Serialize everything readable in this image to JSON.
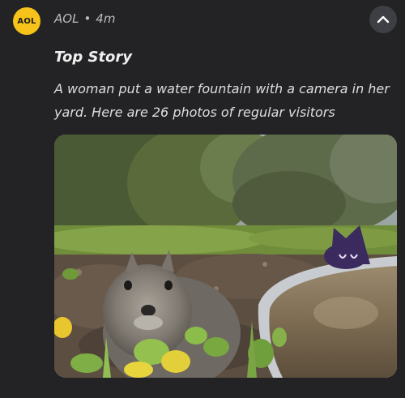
{
  "notification": {
    "app_icon_text": "AOL",
    "app_name": "AOL",
    "separator": "•",
    "time_ago": "4m",
    "title": "Top Story",
    "body": "A woman put a water fountain with a camera in her yard. Here are 26 photos of regular visitors",
    "collapse_icon": "chevron-up-icon"
  },
  "colors": {
    "background": "#232325",
    "aol_badge": "#f7c21a",
    "collapse_button": "#3d3f44"
  }
}
